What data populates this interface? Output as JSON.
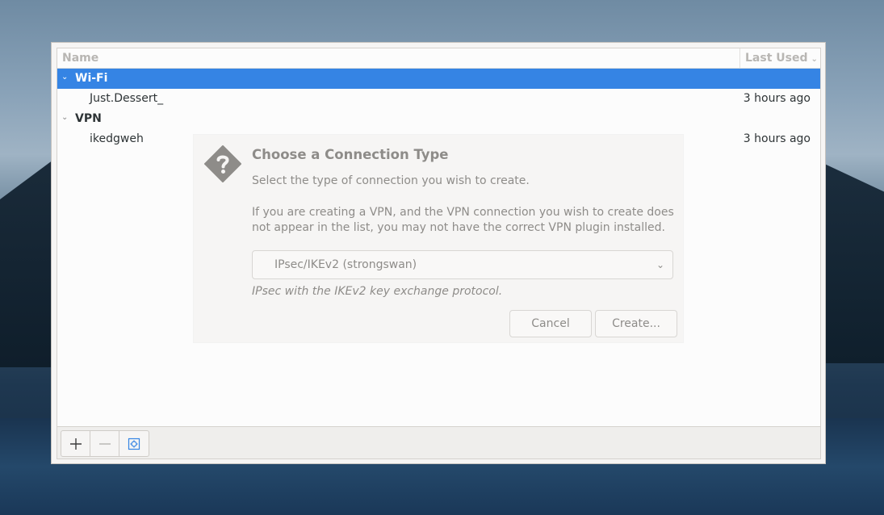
{
  "list": {
    "columns": {
      "name": "Name",
      "last_used": "Last Used"
    },
    "groups": [
      {
        "label": "Wi-Fi",
        "connections": [
          {
            "name": "Just.Dessert_",
            "last_used": "3 hours ago"
          }
        ]
      },
      {
        "label": "VPN",
        "connections": [
          {
            "name": "ikedgweh",
            "last_used": "3 hours ago"
          }
        ]
      }
    ]
  },
  "toolbar": {
    "add_icon": "plus-icon",
    "remove_icon": "minus-icon",
    "settings_icon": "configure-icon"
  },
  "dialog": {
    "title": "Choose a Connection Type",
    "subtitle": "Select the type of connection you wish to create.",
    "info": "If you are creating a VPN, and the VPN connection you wish to create does not appear in the list, you may not have the correct VPN plugin installed.",
    "selected_type": "IPsec/IKEv2 (strongswan)",
    "description": "IPsec with the IKEv2 key exchange protocol.",
    "cancel_label": "Cancel",
    "create_label": "Create..."
  },
  "colors": {
    "selection": "#3584e4"
  }
}
